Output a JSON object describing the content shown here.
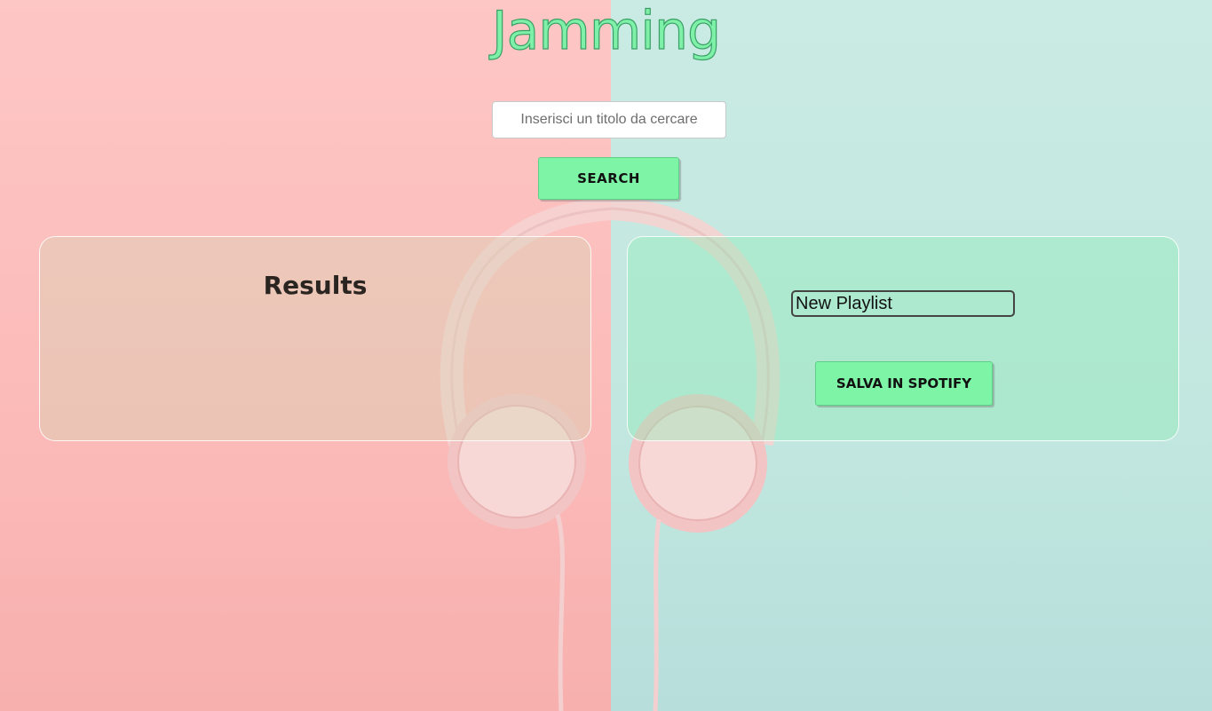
{
  "app": {
    "logo": "Jamming"
  },
  "search": {
    "placeholder": "Inserisci un titolo da cercare",
    "value": "",
    "button_label": "SEARCH"
  },
  "results": {
    "title": "Results",
    "items": []
  },
  "playlist": {
    "name_value": "New Playlist",
    "save_label": "SALVA IN SPOTIFY"
  },
  "colors": {
    "accent": "#7ef5a6",
    "background_left": "#fbbab8",
    "background_right": "#c2e7e0",
    "headphones": "#f4c9c8"
  }
}
